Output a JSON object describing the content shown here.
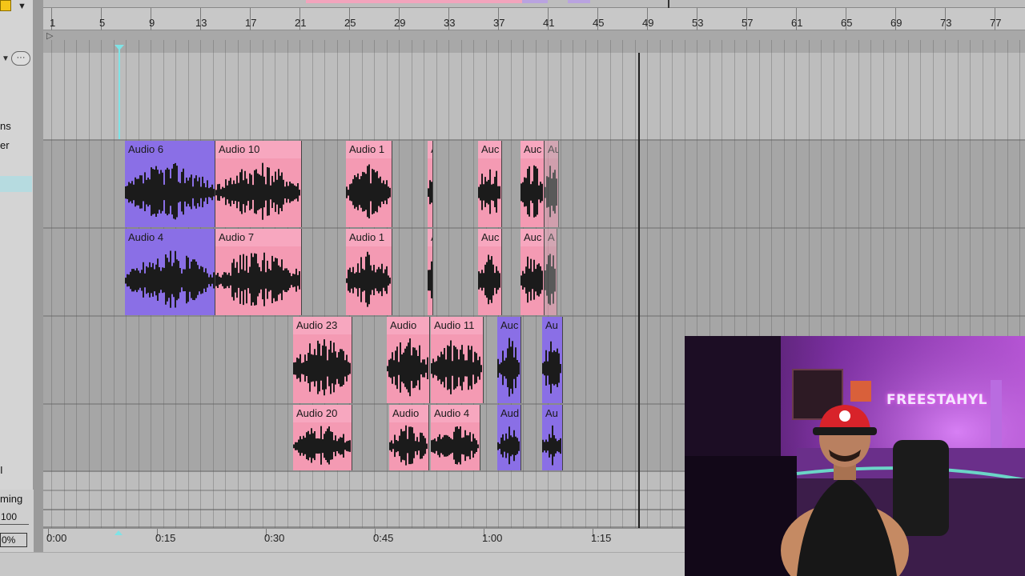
{
  "ruler": {
    "bars": [
      "1",
      "5",
      "9",
      "13",
      "17",
      "21",
      "25",
      "29",
      "33",
      "37",
      "41",
      "45",
      "49",
      "53",
      "57",
      "61",
      "65",
      "69",
      "73",
      "77"
    ]
  },
  "time_ruler": {
    "labels": [
      "0:00",
      "0:15",
      "0:30",
      "0:45",
      "1:00",
      "1:15"
    ]
  },
  "sidebar": {
    "text_1": "ns",
    "text_2": "er",
    "text_3": "I",
    "label_timing": "ming",
    "field_value": "100",
    "field_percent": "0%"
  },
  "tracks": [
    {
      "clips": [
        {
          "name": "Audio 6",
          "color": "purple"
        },
        {
          "name": "Audio 10",
          "color": "pink"
        },
        {
          "name": "Audio 1",
          "color": "pink"
        },
        {
          "name": "A",
          "color": "pink"
        },
        {
          "name": "Auc",
          "color": "pink"
        },
        {
          "name": "Auc",
          "color": "pink"
        },
        {
          "name": "Au",
          "color": "pink"
        }
      ]
    },
    {
      "clips": [
        {
          "name": "Audio 4",
          "color": "purple"
        },
        {
          "name": "Audio 7",
          "color": "pink"
        },
        {
          "name": "Audio 1",
          "color": "pink"
        },
        {
          "name": "A",
          "color": "pink"
        },
        {
          "name": "Auc",
          "color": "pink"
        },
        {
          "name": "Auc",
          "color": "pink"
        },
        {
          "name": "A",
          "color": "pink"
        }
      ]
    },
    {
      "clips": [
        {
          "name": "Audio 23",
          "color": "pink"
        },
        {
          "name": "Audio",
          "color": "pink"
        },
        {
          "name": "Audio 11",
          "color": "pink"
        },
        {
          "name": "Auc",
          "color": "purple"
        },
        {
          "name": "Au",
          "color": "purple"
        }
      ]
    },
    {
      "clips": [
        {
          "name": "Audio 20",
          "color": "pink"
        },
        {
          "name": "Audio",
          "color": "pink"
        },
        {
          "name": "Audio 4",
          "color": "pink"
        },
        {
          "name": "Aud",
          "color": "purple"
        },
        {
          "name": "Au",
          "color": "purple"
        }
      ]
    }
  ],
  "webcam": {
    "sign_text": "FREESTAHYL"
  },
  "colors": {
    "clip_pink": "#f49ab3",
    "clip_purple": "#8a6fe6",
    "playhead": "#7fe3e6",
    "loop_pink": "#f2a4bc",
    "loop_purple": "#b9a3e0"
  },
  "icons": {
    "loop_start": "play-triangle-icon",
    "options": "more-options-icon",
    "track_fold": "fold-triangle-icon"
  }
}
